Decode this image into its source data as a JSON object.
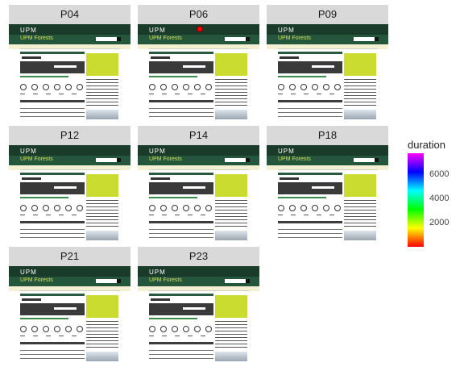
{
  "chart_data": {
    "type": "heatmap",
    "description_free": true,
    "panels": [
      {
        "label": "P04",
        "points": []
      },
      {
        "label": "P06",
        "points": [
          {
            "x": 0.51,
            "y": 0.05,
            "duration": 200
          }
        ]
      },
      {
        "label": "P09",
        "points": []
      },
      {
        "label": "P12",
        "points": []
      },
      {
        "label": "P14",
        "points": []
      },
      {
        "label": "P18",
        "points": []
      },
      {
        "label": "P21",
        "points": []
      },
      {
        "label": "P23",
        "points": []
      }
    ],
    "legend": {
      "title": "duration",
      "ticks": [
        2000,
        4000,
        6000
      ],
      "tick_labels": [
        "2000",
        "4000",
        "6000"
      ],
      "range": [
        0,
        7700
      ],
      "colors": [
        "#ff0000",
        "#ffff00",
        "#00ff00",
        "#00ffff",
        "#0000ff",
        "#ff00ff"
      ]
    },
    "thumbnail": {
      "logo_text": "UPM",
      "sub_text": "UPM Forests"
    }
  }
}
